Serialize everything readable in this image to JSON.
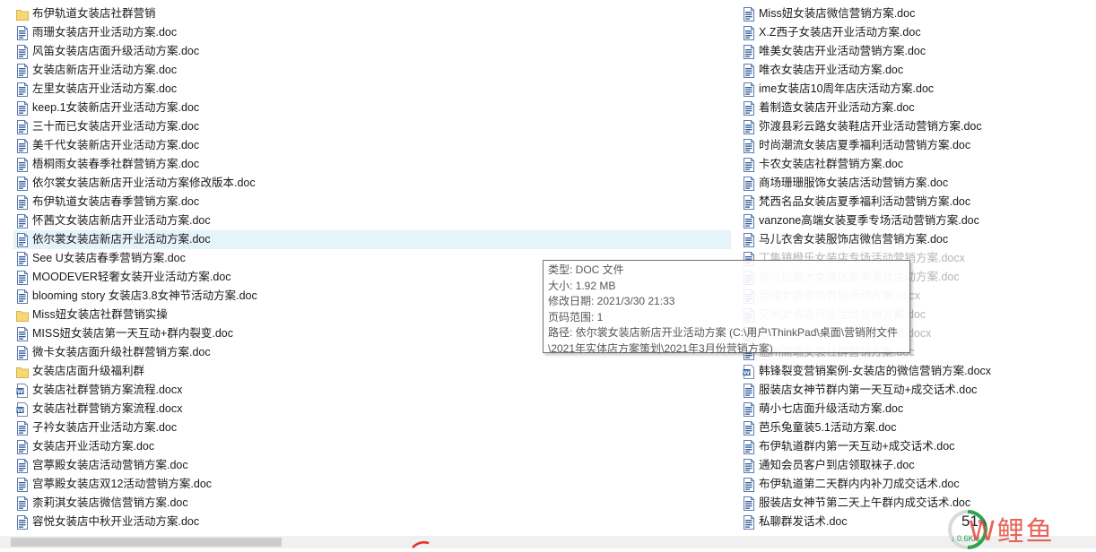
{
  "files_left": [
    {
      "name": "布伊轨道女装店社群营销",
      "type": "folder"
    },
    {
      "name": "雨珊女装店开业活动方案.doc",
      "type": "doc"
    },
    {
      "name": "风笛女装店店面升级活动方案.doc",
      "type": "doc"
    },
    {
      "name": "女装店新店开业活动方案.doc",
      "type": "doc"
    },
    {
      "name": "左里女装店开业活动方案.doc",
      "type": "doc"
    },
    {
      "name": "keep.1女装新店开业活动方案.doc",
      "type": "doc"
    },
    {
      "name": "三十而已女装店开业活动方案.doc",
      "type": "doc"
    },
    {
      "name": "美千代女装新店开业活动方案.doc",
      "type": "doc"
    },
    {
      "name": "梧桐雨女装春季社群营销方案.doc",
      "type": "doc"
    },
    {
      "name": "依尔裳女装店新店开业活动方案修改版本.doc",
      "type": "doc"
    },
    {
      "name": "布伊轨道女装店春季营销方案.doc",
      "type": "doc"
    },
    {
      "name": "怀茜文女装店新店开业活动方案.doc",
      "type": "doc"
    },
    {
      "name": "依尔裳女装店新店开业活动方案.doc",
      "type": "doc",
      "selected": true
    },
    {
      "name": "See U女装店春季营销方案.doc",
      "type": "doc"
    },
    {
      "name": "MOODEVER轻奢女装开业活动方案.doc",
      "type": "doc"
    },
    {
      "name": "blooming story 女装店3.8女神节活动方案.doc",
      "type": "doc"
    },
    {
      "name": "Miss妞女装店社群营销实操",
      "type": "folder"
    },
    {
      "name": "MISS妞女装店第一天互动+群内裂变.doc",
      "type": "doc"
    },
    {
      "name": "微卡女装店面升级社群营销方案.doc",
      "type": "doc"
    },
    {
      "name": "女装店店面升级福利群",
      "type": "folder"
    },
    {
      "name": "女装店社群营销方案流程.docx",
      "type": "docx"
    },
    {
      "name": "女装店社群营销方案流程.docx",
      "type": "docx"
    },
    {
      "name": "子衿女装店开业活动方案.doc",
      "type": "doc"
    },
    {
      "name": "女装店开业活动方案.doc",
      "type": "doc"
    },
    {
      "name": "宫葶殿女装店活动营销方案.doc",
      "type": "doc"
    },
    {
      "name": "宫葶殿女装店双12活动营销方案.doc",
      "type": "doc"
    },
    {
      "name": "柰莉淇女装店微信营销方案.doc",
      "type": "doc"
    },
    {
      "name": "容悦女装店中秋开业活动方案.doc",
      "type": "doc"
    }
  ],
  "files_right": [
    {
      "name": "Miss妞女装店微信营销方案.doc",
      "type": "doc"
    },
    {
      "name": "X.Z西子女装店开业活动方案.doc",
      "type": "doc"
    },
    {
      "name": "唯美女装店开业活动营销方案.doc",
      "type": "doc"
    },
    {
      "name": "唯衣女装店开业活动方案.doc",
      "type": "doc"
    },
    {
      "name": "ime女装店10周年店庆活动方案.doc",
      "type": "doc"
    },
    {
      "name": "着制造女装店开业活动方案.doc",
      "type": "doc"
    },
    {
      "name": "弥渡县彩云路女装鞋店开业活动营销方案.doc",
      "type": "doc"
    },
    {
      "name": "时尚潮流女装店夏季福利活动营销方案.doc",
      "type": "doc"
    },
    {
      "name": "卡农女装店社群营销方案.doc",
      "type": "doc"
    },
    {
      "name": "商场珊珊服饰女装店活动营销方案.doc",
      "type": "doc"
    },
    {
      "name": "梵西名品女装店夏季福利活动营销方案.doc",
      "type": "doc"
    },
    {
      "name": "vanzone高端女装夏季专场活动营销方案.doc",
      "type": "doc"
    },
    {
      "name": "马儿衣舍女装服饰店微信营销方案.doc",
      "type": "doc"
    },
    {
      "name": "丁集镇橙乐女装店专场活动营销方案.docx",
      "type": "doc",
      "ghost": true
    },
    {
      "name": "侯马加嘉大女装店夏季清仓活动方案.doc",
      "type": "doc",
      "ghost": true
    },
    {
      "name": "百瑞女装专场营销活动方案.docx",
      "type": "doc",
      "ghost": true
    },
    {
      "name": "艾米女装店开业活动营销方案.doc",
      "type": "doc",
      "ghost": true
    },
    {
      "name": "融安会员女装店社群营销方案.docx",
      "type": "doc",
      "ghost": true
    },
    {
      "name": "温州高端女装社群营销方案.doc",
      "type": "doc",
      "ghost": true
    },
    {
      "name": "韩锋裂变营销案例-女装店的微信营销方案.docx",
      "type": "docx"
    },
    {
      "name": "服装店女神节群内第一天互动+成交话术.doc",
      "type": "doc"
    },
    {
      "name": "萌小七店面升级活动方案.doc",
      "type": "doc"
    },
    {
      "name": "芭乐兔童装5.1活动方案.doc",
      "type": "doc"
    },
    {
      "name": "布伊轨道群内第一天互动+成交话术.doc",
      "type": "doc"
    },
    {
      "name": "通知会员客户到店领取袜子.doc",
      "type": "doc"
    },
    {
      "name": "布伊轨道第二天群内内补刀成交话术.doc",
      "type": "doc"
    },
    {
      "name": "服装店女神节第二天上午群内成交话术.doc",
      "type": "doc"
    },
    {
      "name": "私聊群发话术.doc",
      "type": "doc"
    }
  ],
  "tooltip": {
    "type": "类型: DOC 文件",
    "size": "大小: 1.92 MB",
    "modified": "修改日期: 2021/3/30 21:33",
    "pages": "页码范围: 1",
    "path1": "路径: 依尔裳女装店新店开业活动方案 (C:\\用户\\ThinkPad\\桌面\\营销附文件",
    "path2": "\\2021年实体店方案策划\\2021年3月份营销方案)"
  },
  "watermark": {
    "percent": "51",
    "percent_sign": "%",
    "speed": "↓ 0.6K/s",
    "brand": "W鲤鱼"
  },
  "colors": {
    "selected_bg": "#e5f3fb",
    "folder": "#f8d775",
    "doc_blue": "#2b579a"
  }
}
